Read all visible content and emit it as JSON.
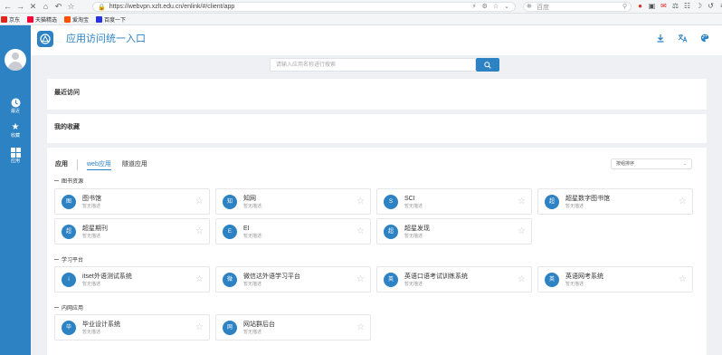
{
  "browser": {
    "url": "https://webvpn.xzlt.edu.cn/enlink/#/client/app",
    "search_placeholder": "百度",
    "bookmarks": [
      {
        "label": "京东",
        "color": "#e1251b"
      },
      {
        "label": "天猫精选",
        "color": "#ff0036"
      },
      {
        "label": "爱淘宝",
        "color": "#ff5000"
      },
      {
        "label": "百度一下",
        "color": "#2932e1"
      }
    ]
  },
  "header": {
    "title": "应用访问统一入口"
  },
  "sidebar": {
    "items": [
      {
        "label": "最近",
        "icon": "clock-icon"
      },
      {
        "label": "收藏",
        "icon": "star-icon"
      },
      {
        "label": "应用",
        "icon": "grid-icon"
      }
    ]
  },
  "search": {
    "placeholder": "请输入应用名称进行搜索"
  },
  "sections": {
    "recent": "最近访问",
    "favorites": "我的收藏"
  },
  "tabs": {
    "all": "应用",
    "web": "web应用",
    "tunnel": "隧道应用"
  },
  "sort": {
    "selected": "按组排序"
  },
  "categories": [
    {
      "label": "图书资源",
      "apps": [
        {
          "icon_text": "图",
          "name": "图书馆",
          "desc": "暂无描述"
        },
        {
          "icon_text": "知",
          "name": "知网",
          "desc": "暂无描述"
        },
        {
          "icon_text": "S",
          "name": "SCI",
          "desc": "暂无描述"
        },
        {
          "icon_text": "超",
          "name": "超星数字图书馆",
          "desc": "暂无描述"
        },
        {
          "icon_text": "超",
          "name": "超星期刊",
          "desc": "暂无描述"
        },
        {
          "icon_text": "E",
          "name": "EI",
          "desc": "暂无描述"
        },
        {
          "icon_text": "超",
          "name": "超星发现",
          "desc": "暂无描述"
        }
      ]
    },
    {
      "label": "学习平台",
      "apps": [
        {
          "icon_text": "i",
          "name": "itset外语测试系统",
          "desc": "暂无描述"
        },
        {
          "icon_text": "微",
          "name": "微信达外语学习平台",
          "desc": "暂无描述"
        },
        {
          "icon_text": "英",
          "name": "英语口语考试训练系统",
          "desc": "暂无描述"
        },
        {
          "icon_text": "英",
          "name": "英语网考系统",
          "desc": "暂无描述"
        }
      ]
    },
    {
      "label": "内网应用",
      "apps": [
        {
          "icon_text": "毕",
          "name": "毕业设计系统",
          "desc": "暂无描述"
        },
        {
          "icon_text": "网",
          "name": "网站群后台",
          "desc": "暂无描述"
        }
      ]
    }
  ]
}
